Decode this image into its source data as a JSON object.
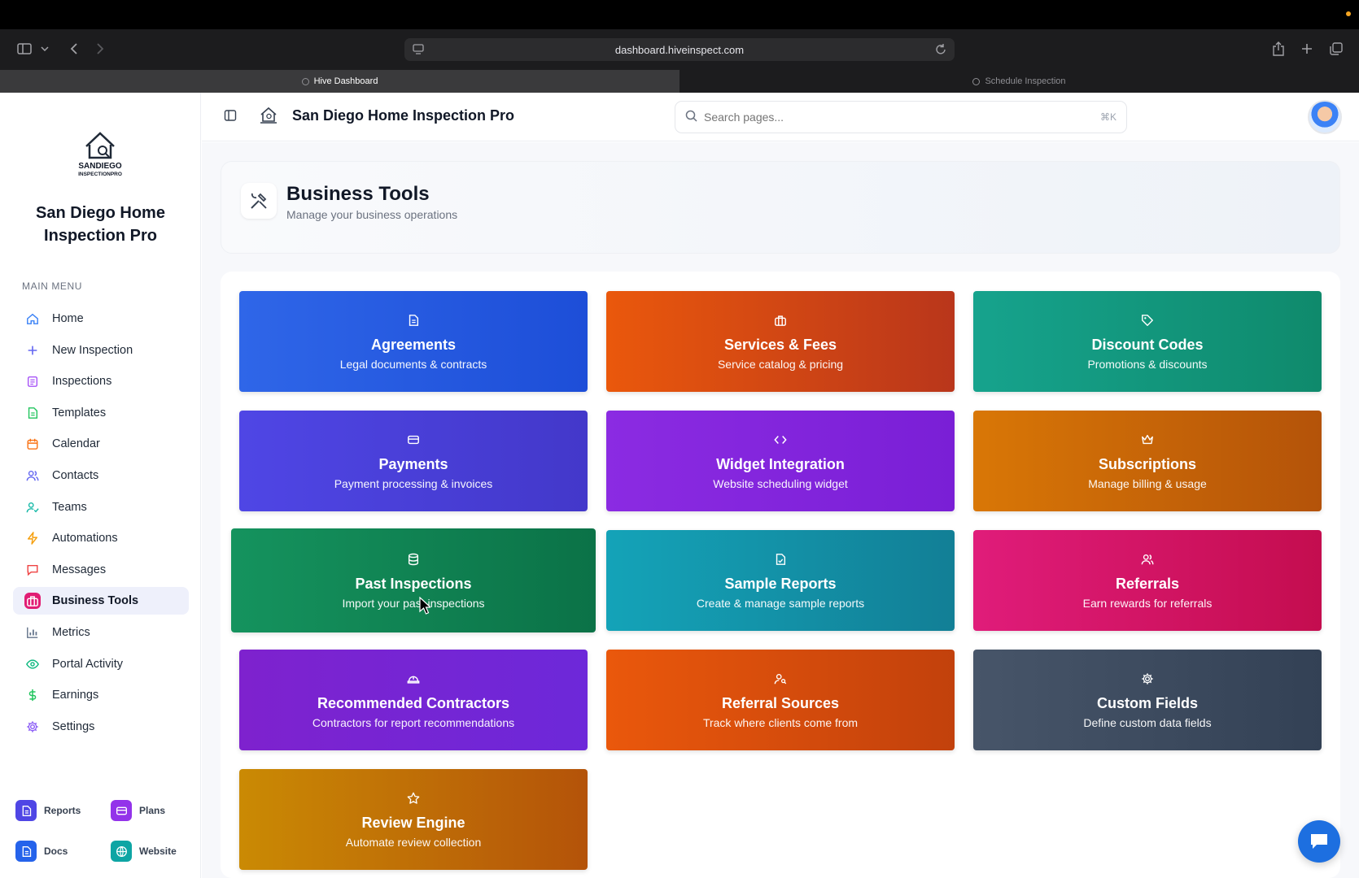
{
  "browser": {
    "url": "dashboard.hiveinspect.com",
    "tabs": [
      {
        "label": "Hive Dashboard",
        "active": true
      },
      {
        "label": "Schedule Inspection",
        "active": false
      }
    ]
  },
  "sidebar": {
    "brand": "San Diego Home Inspection Pro",
    "logo_text": "SANDIEGO INSPECTIONPRO",
    "menu_title": "MAIN MENU",
    "items": [
      {
        "label": "Home",
        "icon": "home-icon",
        "color": "#3b82f6"
      },
      {
        "label": "New Inspection",
        "icon": "plus-icon",
        "color": "#6366f1"
      },
      {
        "label": "Inspections",
        "icon": "clipboard-icon",
        "color": "#a855f7"
      },
      {
        "label": "Templates",
        "icon": "document-icon",
        "color": "#22c55e"
      },
      {
        "label": "Calendar",
        "icon": "calendar-icon",
        "color": "#f97316"
      },
      {
        "label": "Contacts",
        "icon": "users-icon",
        "color": "#6366f1"
      },
      {
        "label": "Teams",
        "icon": "user-check-icon",
        "color": "#14b8a6"
      },
      {
        "label": "Automations",
        "icon": "bolt-icon",
        "color": "#f59e0b"
      },
      {
        "label": "Messages",
        "icon": "message-icon",
        "color": "#ef4444"
      },
      {
        "label": "Business Tools",
        "icon": "briefcase-icon",
        "color": "#e11d74",
        "active": true
      },
      {
        "label": "Metrics",
        "icon": "bar-chart-icon",
        "color": "#64748b"
      },
      {
        "label": "Portal Activity",
        "icon": "eye-icon",
        "color": "#10b981"
      },
      {
        "label": "Earnings",
        "icon": "dollar-icon",
        "color": "#22c55e"
      },
      {
        "label": "Settings",
        "icon": "gear-icon",
        "color": "#8b5cf6"
      }
    ],
    "quick_links": [
      {
        "label": "Reports",
        "icon": "report-icon",
        "color": "#4f46e5"
      },
      {
        "label": "Plans",
        "icon": "card-icon",
        "color": "#9333ea"
      },
      {
        "label": "Docs",
        "icon": "doc-icon",
        "color": "#2563eb"
      },
      {
        "label": "Website",
        "icon": "globe-icon",
        "color": "#0ea5a4"
      }
    ]
  },
  "header": {
    "title": "San Diego Home Inspection Pro",
    "search_placeholder": "Search pages...",
    "search_shortcut": "⌘K"
  },
  "page": {
    "title": "Business Tools",
    "subtitle": "Manage your business operations"
  },
  "tools": [
    {
      "title": "Agreements",
      "subtitle": "Legal documents & contracts",
      "icon": "document-icon",
      "color_from": "#2f66e8",
      "color_to": "#1d4ed8"
    },
    {
      "title": "Services & Fees",
      "subtitle": "Service catalog & pricing",
      "icon": "briefcase-icon",
      "color_from": "#ea580c",
      "color_to": "#b9361b"
    },
    {
      "title": "Discount Codes",
      "subtitle": "Promotions & discounts",
      "icon": "tag-icon",
      "color_from": "#16a38d",
      "color_to": "#0f8a6c"
    },
    {
      "title": "Payments",
      "subtitle": "Payment processing & invoices",
      "icon": "credit-card-icon",
      "color_from": "#4f46e5",
      "color_to": "#4338ca"
    },
    {
      "title": "Widget Integration",
      "subtitle": "Website scheduling widget",
      "icon": "code-icon",
      "color_from": "#8b2be2",
      "color_to": "#7a1fd6"
    },
    {
      "title": "Subscriptions",
      "subtitle": "Manage billing & usage",
      "icon": "crown-icon",
      "color_from": "#d97706",
      "color_to": "#b45309"
    },
    {
      "title": "Past Inspections",
      "subtitle": "Import your past inspections",
      "icon": "database-icon",
      "color_from": "#15935e",
      "color_to": "#0b7247"
    },
    {
      "title": "Sample Reports",
      "subtitle": "Create & manage sample reports",
      "icon": "file-check-icon",
      "color_from": "#14a3b8",
      "color_to": "#127f96"
    },
    {
      "title": "Referrals",
      "subtitle": "Earn rewards for referrals",
      "icon": "users-icon",
      "color_from": "#e01c7a",
      "color_to": "#c40d4f"
    },
    {
      "title": "Recommended Contractors",
      "subtitle": "Contractors for report recommendations",
      "icon": "hardhat-icon",
      "color_from": "#7e22ce",
      "color_to": "#6d28d9"
    },
    {
      "title": "Referral Sources",
      "subtitle": "Track where clients come from",
      "icon": "user-search-icon",
      "color_from": "#ea580c",
      "color_to": "#c2410c"
    },
    {
      "title": "Custom Fields",
      "subtitle": "Define custom data fields",
      "icon": "gear-icon",
      "color_from": "#475569",
      "color_to": "#334155"
    },
    {
      "title": "Review Engine",
      "subtitle": "Automate review collection",
      "icon": "star-icon",
      "color_from": "#ca8a04",
      "color_to": "#b45309"
    }
  ]
}
